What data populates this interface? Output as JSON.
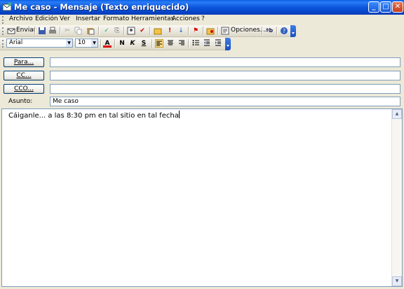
{
  "window": {
    "title": "Me caso - Mensaje (Texto enriquecido)",
    "controls": [
      "_",
      "□",
      "✕"
    ]
  },
  "menubar": {
    "items": [
      "Archivo",
      "Edición",
      "Ver",
      "Insertar",
      "Formato",
      "Herramientas",
      "Acciones",
      "?"
    ]
  },
  "toolbar_standard": {
    "send_label": "Enviar",
    "options_label": "Opciones...",
    "icons": [
      "send-icon",
      "save-icon",
      "print-icon",
      "cut-icon",
      "copy-icon",
      "paste-icon",
      "spelling-icon",
      "attach-icon",
      "address-book-icon",
      "check-names-icon",
      "insert-file-icon",
      "importance-high-icon",
      "importance-low-icon",
      "flag-icon",
      "permission-icon",
      "options-icon",
      "translate-icon",
      "help-icon"
    ]
  },
  "toolbar_format": {
    "font": "Arial",
    "size": "10",
    "bold": "N",
    "italic": "K",
    "underline": "S",
    "font_color_glyph": "A"
  },
  "header": {
    "to_label": "Para...",
    "cc_label": "CC...",
    "bcc_label": "CCO...",
    "to_value": "",
    "cc_value": "",
    "bcc_value": "",
    "subject_label": "Asunto:",
    "subject_value": "Me caso"
  },
  "body": {
    "text": "Cáiganle... a las 8:30 pm en tal sitio en tal fecha"
  },
  "colors": {
    "titlebar": "#0A5FE6",
    "face": "#ECE9D8",
    "field_border": "#7F9DB9"
  }
}
